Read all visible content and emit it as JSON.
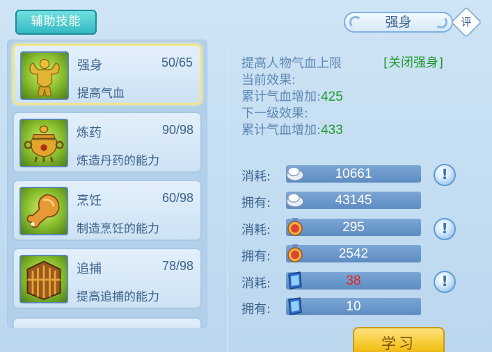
{
  "tab": {
    "label": "辅助技能"
  },
  "skills": [
    {
      "name": "强身",
      "level": "50/65",
      "desc": "提高气血",
      "icon": "muscle-man-icon",
      "selected": true
    },
    {
      "name": "炼药",
      "level": "90/98",
      "desc": "炼造丹药的能力",
      "icon": "alchemy-cauldron-icon"
    },
    {
      "name": "烹饪",
      "level": "60/98",
      "desc": "制造烹饪的能力",
      "icon": "drumstick-icon"
    },
    {
      "name": "追捕",
      "level": "78/98",
      "desc": "提高追捕的能力",
      "icon": "cage-icon"
    }
  ],
  "detail": {
    "title": "强身",
    "rate_label": "评",
    "summary": "提高人物气血上限",
    "close_link": "[关闭强身]",
    "current_label": "当前效果:",
    "current_stat_label": "累计气血增加:",
    "current_stat_value": "425",
    "next_label": "下一级效果:",
    "next_stat_label": "累计气血增加:",
    "next_stat_value": "433"
  },
  "resources": [
    {
      "label": "消耗:",
      "value": "10661",
      "icon": "silver-coin-icon",
      "warn": true
    },
    {
      "label": "拥有:",
      "value": "43145",
      "icon": "silver-coin-icon",
      "warn": false
    },
    {
      "label": "消耗:",
      "value": "295",
      "icon": "contribution-badge-icon",
      "warn": true
    },
    {
      "label": "拥有:",
      "value": "2542",
      "icon": "contribution-badge-icon",
      "warn": false
    },
    {
      "label": "消耗:",
      "value": "38",
      "icon": "skill-book-icon",
      "warn": true,
      "highlight_color": "#e1261c"
    },
    {
      "label": "拥有:",
      "value": "10",
      "icon": "skill-book-icon",
      "warn": false
    }
  ],
  "warn_symbol": "!",
  "learn_button": {
    "label": "学习"
  }
}
